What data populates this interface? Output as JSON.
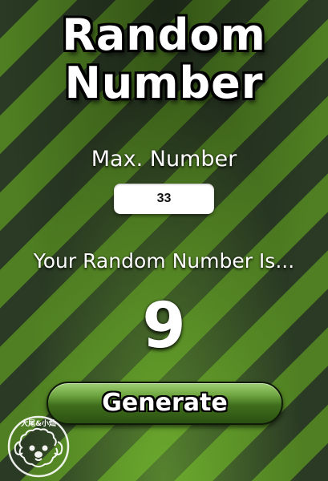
{
  "app": {
    "title_line1": "Random",
    "title_line2": "Number"
  },
  "max": {
    "label": "Max. Number",
    "value": "33"
  },
  "result": {
    "label": "Your Random Number Is...",
    "value": "9"
  },
  "actions": {
    "generate_label": "Generate"
  },
  "watermark": {
    "text": "大尾&小灿",
    "icon": "dog-face-logo"
  },
  "colors": {
    "stripe_dark": "#2a3a24",
    "stripe_green": "#4f7f22",
    "text": "#ffffff",
    "button_top": "#9ecf73",
    "button_bottom": "#2b5012"
  }
}
